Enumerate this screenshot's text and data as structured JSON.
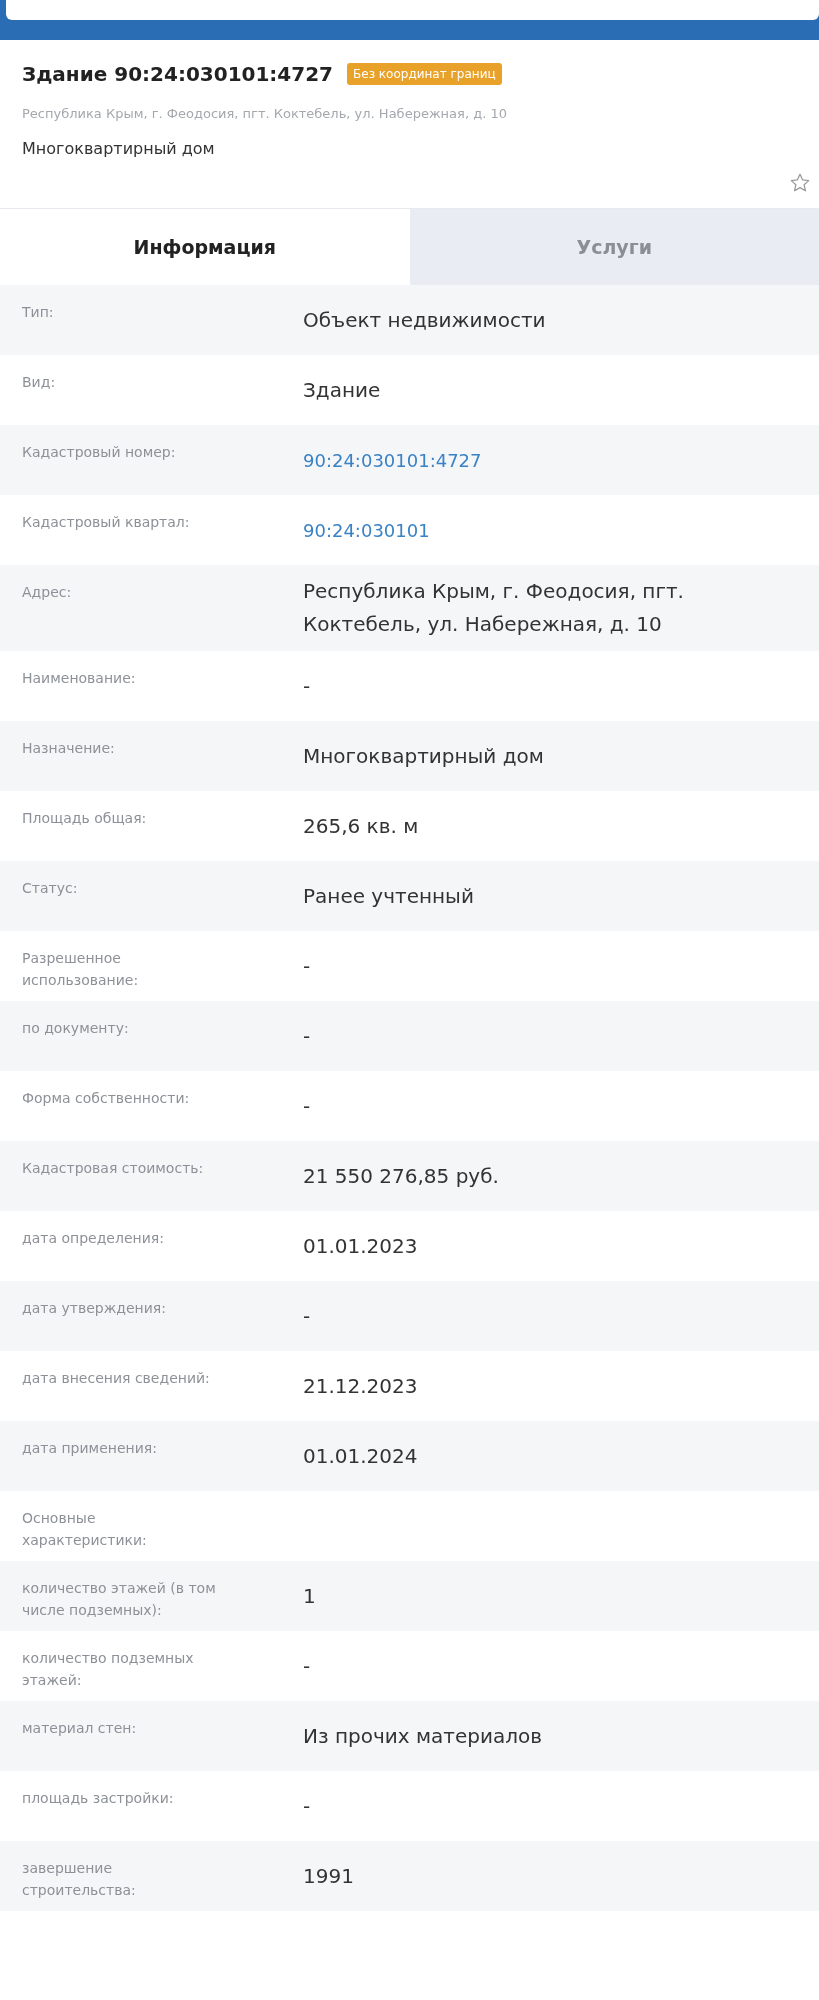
{
  "header": {
    "title": "Здание 90:24:030101:4727",
    "badge": "Без координат границ",
    "address": "Республика Крым, г. Феодосия, пгт. Коктебель, ул. Набережная, д. 10",
    "subtitle": "Многоквартирный дом",
    "favorite": false
  },
  "tabs": [
    {
      "label": "Информация",
      "selected": true
    },
    {
      "label": "Услуги",
      "selected": false
    }
  ],
  "rows": [
    {
      "label": "Тип:",
      "value": "Объект недвижимости",
      "kind": "text"
    },
    {
      "label": "Вид:",
      "value": "Здание",
      "kind": "text"
    },
    {
      "label": "Кадастровый номер:",
      "value": "90:24:030101:4727",
      "kind": "link"
    },
    {
      "label": "Кадастровый квартал:",
      "value": "90:24:030101",
      "kind": "link"
    },
    {
      "label": "Адрес:",
      "value": "Республика Крым, г. Феодосия, пгт. Коктебель, ул. Набережная, д. 10",
      "kind": "text"
    },
    {
      "label": "Наименование:",
      "value": "-",
      "kind": "text"
    },
    {
      "label": "Назначение:",
      "value": "Многоквартирный дом",
      "kind": "text"
    },
    {
      "label": "Площадь общая:",
      "value": "265,6 кв. м",
      "kind": "text"
    },
    {
      "label": "Статус:",
      "value": "Ранее учтенный",
      "kind": "text"
    },
    {
      "label": "Разрешенное использование:",
      "value": "-",
      "kind": "text"
    },
    {
      "label": "по документу:",
      "value": "-",
      "kind": "text"
    },
    {
      "label": "Форма собственности:",
      "value": "-",
      "kind": "text"
    },
    {
      "label": "Кадастровая стоимость:",
      "value": "21 550 276,85 руб.",
      "kind": "text"
    },
    {
      "label": "дата определения:",
      "value": "01.01.2023",
      "kind": "text"
    },
    {
      "label": "дата утверждения:",
      "value": "-",
      "kind": "text"
    },
    {
      "label": "дата внесения сведений:",
      "value": "21.12.2023",
      "kind": "text"
    },
    {
      "label": "дата применения:",
      "value": "01.01.2024",
      "kind": "text"
    },
    {
      "label": "Основные характеристики:"
    },
    {
      "label": "количество этажей (в том числе подземных):",
      "value": "1",
      "kind": "text"
    },
    {
      "label": "количество подземных этажей:",
      "value": "-",
      "kind": "text"
    },
    {
      "label": "материал стен:",
      "value": "Из прочих материалов",
      "kind": "text"
    },
    {
      "label": "площадь застройки:",
      "value": "-",
      "kind": "text"
    },
    {
      "label": "завершение строительства:",
      "value": "1991",
      "kind": "text"
    }
  ]
}
